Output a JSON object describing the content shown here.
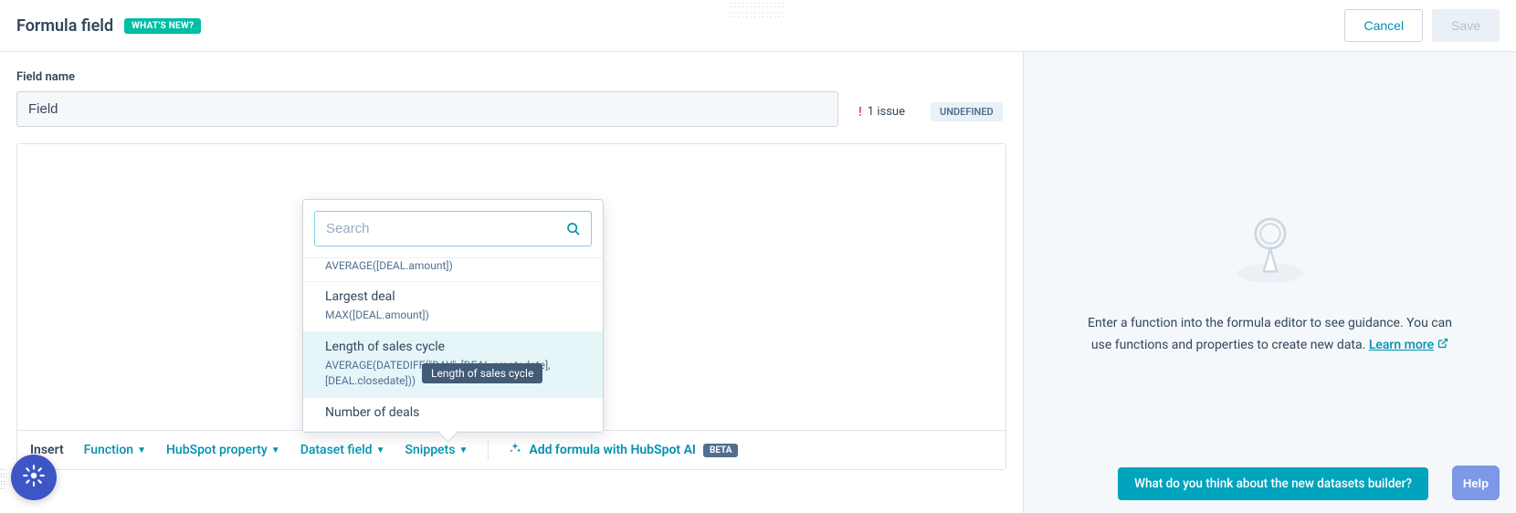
{
  "header": {
    "title": "Formula field",
    "whats_new": "WHAT'S NEW?",
    "cancel": "Cancel",
    "save": "Save"
  },
  "field": {
    "label": "Field name",
    "value": "Field"
  },
  "status": {
    "issue_count": "1 issue",
    "type_badge": "UNDEFINED"
  },
  "insert_bar": {
    "label": "Insert",
    "function": "Function",
    "hubspot_property": "HubSpot property",
    "dataset_field": "Dataset field",
    "snippets": "Snippets",
    "ai_link": "Add formula with HubSpot AI",
    "beta": "BETA"
  },
  "popover": {
    "search_placeholder": "Search",
    "items": [
      {
        "title": "",
        "formula": "AVERAGE([DEAL.amount])",
        "partial_top": true
      },
      {
        "title": "Largest deal",
        "formula": "MAX([DEAL.amount])"
      },
      {
        "title": "Length of sales cycle",
        "formula": "AVERAGE(DATEDIFF(\"DAY\", [DEAL.createdate], [DEAL.closedate]))",
        "hover": true,
        "tooltip": "Length of sales cycle"
      },
      {
        "title": "Number of deals",
        "formula": ""
      }
    ]
  },
  "guidance": {
    "text": "Enter a function into the formula editor to see guidance. You can use functions and properties to create new data.",
    "learn_more": "Learn more"
  },
  "footer": {
    "feedback": "What do you think about the new datasets builder?",
    "help": "Help"
  }
}
